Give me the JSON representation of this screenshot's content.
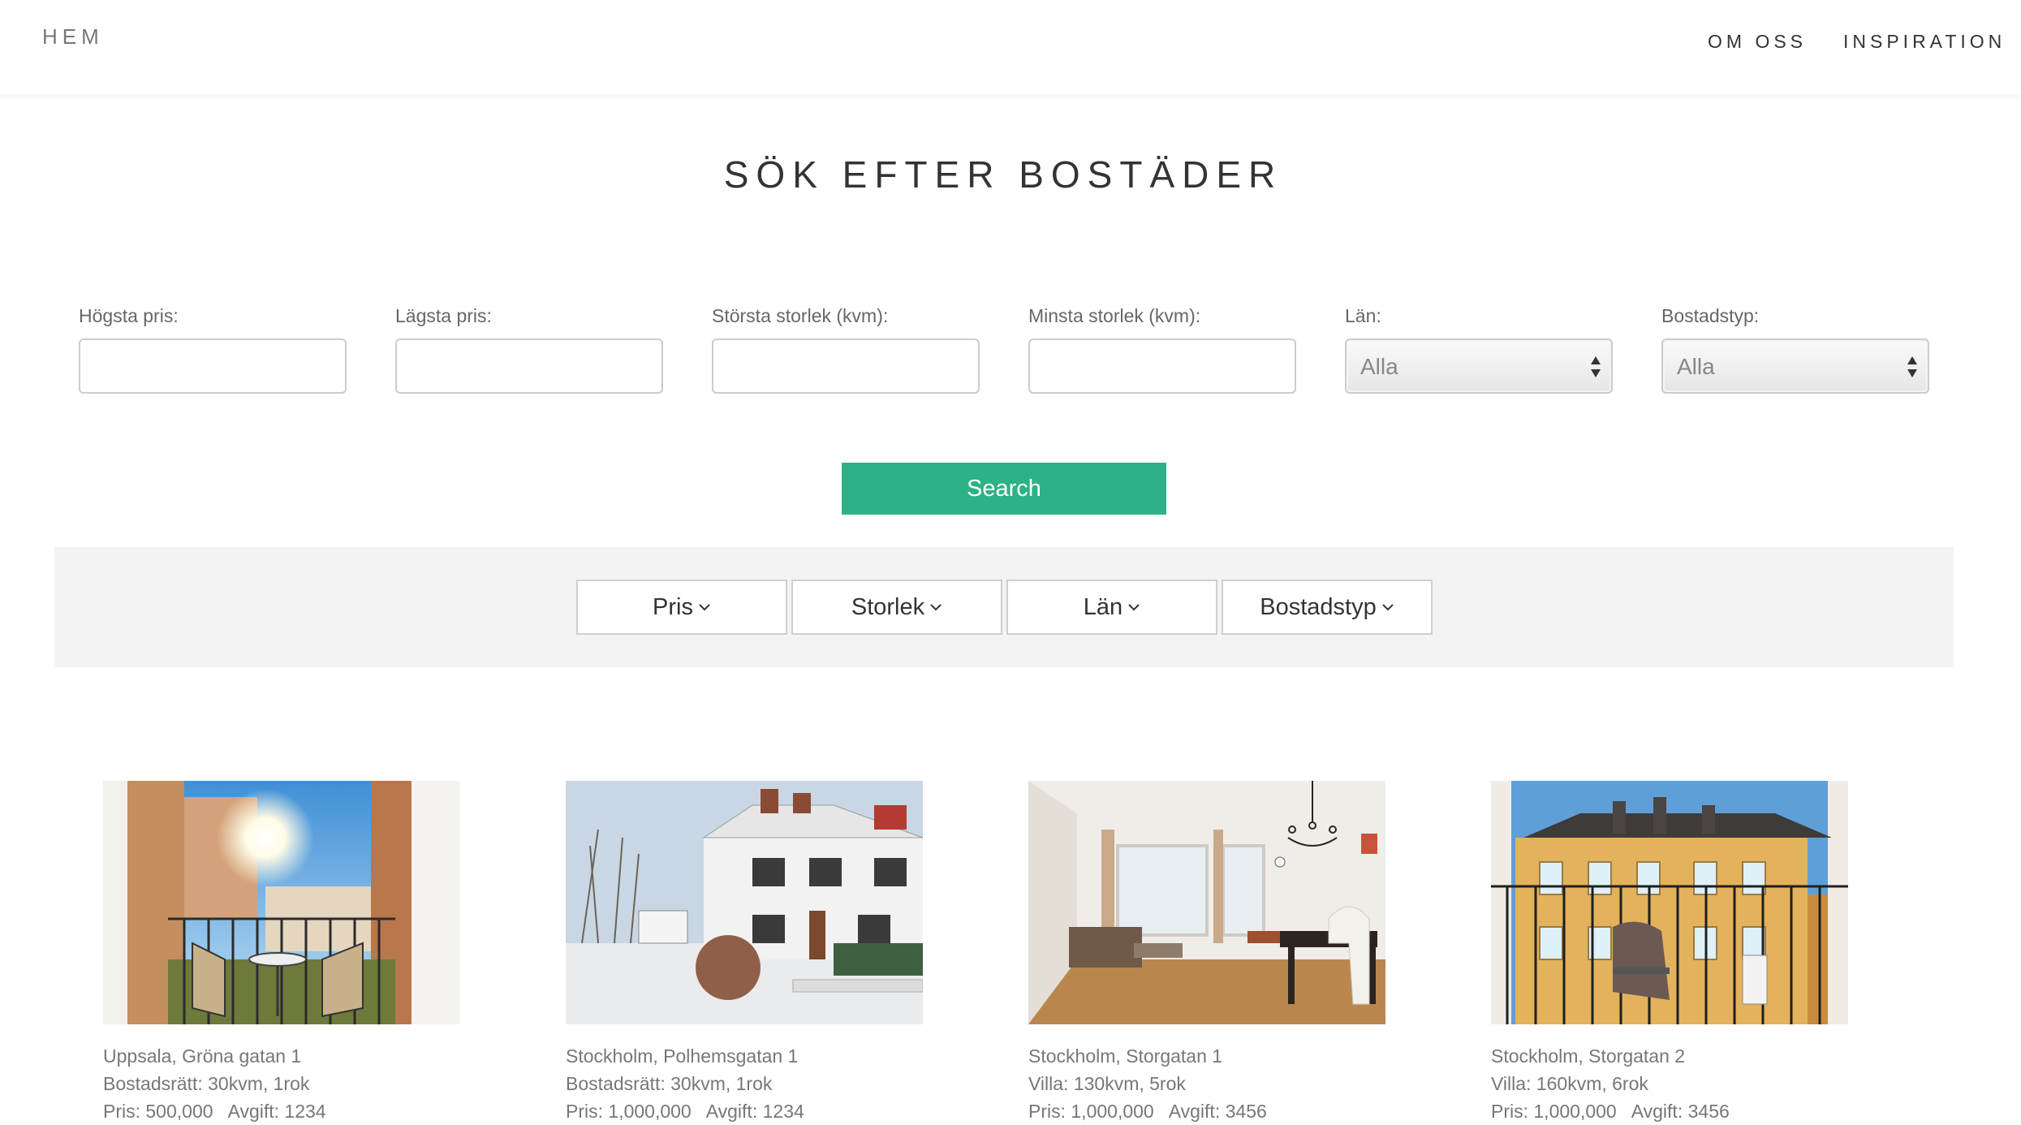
{
  "nav": {
    "brand": "HEM",
    "links": [
      "OM OSS",
      "INSPIRATION"
    ]
  },
  "page": {
    "title": "SÖK EFTER BOSTÄDER"
  },
  "filters": {
    "max_price": {
      "label": "Högsta pris:",
      "value": ""
    },
    "min_price": {
      "label": "Lägsta pris:",
      "value": ""
    },
    "max_size": {
      "label": "Största storlek (kvm):",
      "value": ""
    },
    "min_size": {
      "label": "Minsta storlek (kvm):",
      "value": ""
    },
    "county": {
      "label": "Län:",
      "selected": "Alla"
    },
    "type": {
      "label": "Bostadstyp:",
      "selected": "Alla"
    }
  },
  "search_button": "Search",
  "sort": [
    {
      "label": "Pris"
    },
    {
      "label": "Storlek"
    },
    {
      "label": "Län"
    },
    {
      "label": "Bostadstyp"
    }
  ],
  "listings": [
    {
      "address": "Uppsala, Gröna gatan 1",
      "details": "Bostadsrätt: 30kvm, 1rok",
      "price": "Pris: 500,000",
      "fee": "Avgift: 1234",
      "photo_icon": "balcony-photo"
    },
    {
      "address": "Stockholm, Polhemsgatan 1",
      "details": "Bostadsrätt: 30kvm, 1rok",
      "price": "Pris: 1,000,000",
      "fee": "Avgift: 1234",
      "photo_icon": "house-photo"
    },
    {
      "address": "Stockholm, Storgatan 1",
      "details": "Villa: 130kvm, 5rok",
      "price": "Pris: 1,000,000",
      "fee": "Avgift: 3456",
      "photo_icon": "living-room-photo"
    },
    {
      "address": "Stockholm, Storgatan 2",
      "details": "Villa: 160kvm, 6rok",
      "price": "Pris: 1,000,000",
      "fee": "Avgift: 3456",
      "photo_icon": "balcony-photo"
    }
  ],
  "colors": {
    "accent": "#2db186",
    "sortbar_bg": "#f3f3f3"
  }
}
